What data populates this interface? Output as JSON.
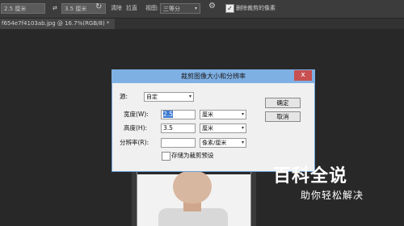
{
  "options_bar": {
    "width_value": "2.5 厘米",
    "swap_symbol": "⇄",
    "height_value": "3.5 厘米",
    "clear_label": "清除",
    "straighten_label": "拉直",
    "view_label": "视图:",
    "view_value": "三等分",
    "delete_cropped_label": "删除裁剪的像素",
    "delete_cropped_checked": true
  },
  "document_tab": {
    "label": "f654e7f4103ab.jpg @ 16.7%(RGB/8) *"
  },
  "dialog": {
    "title": "裁剪图像大小和分辨率",
    "close_glyph": "x",
    "source_label": "源:",
    "source_value": "自定",
    "width_label": "宽度(W):",
    "width_value": "2.5",
    "width_unit": "厘米",
    "height_label": "高度(H):",
    "height_value": "3.5",
    "height_unit": "厘米",
    "resolution_label": "分辨率(R):",
    "resolution_value": "",
    "resolution_unit": "像素/厘米",
    "save_preset_label": "存储为裁剪预设",
    "ok_label": "确定",
    "cancel_label": "取消"
  },
  "watermark": {
    "title": "百科全说",
    "subtitle": "助你轻松解决"
  }
}
